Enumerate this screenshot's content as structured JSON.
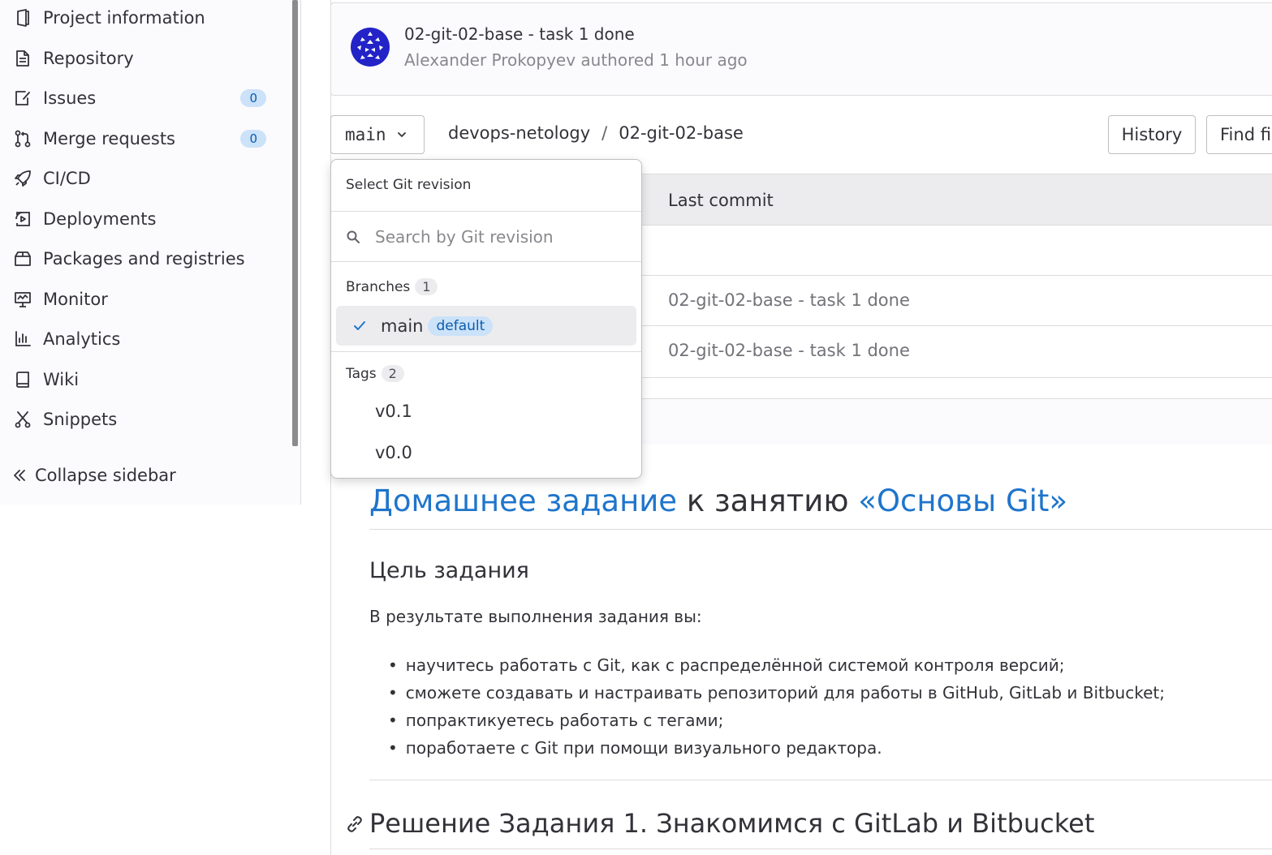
{
  "sidebar": {
    "items": [
      {
        "label": "Project information",
        "icon": "project-icon"
      },
      {
        "label": "Repository",
        "icon": "document-icon"
      },
      {
        "label": "Issues",
        "icon": "issues-icon",
        "badge": "0"
      },
      {
        "label": "Merge requests",
        "icon": "merge-request-icon",
        "badge": "0"
      },
      {
        "label": "CI/CD",
        "icon": "rocket-icon"
      },
      {
        "label": "Deployments",
        "icon": "deployments-icon"
      },
      {
        "label": "Packages and registries",
        "icon": "package-icon"
      },
      {
        "label": "Monitor",
        "icon": "monitor-icon"
      },
      {
        "label": "Analytics",
        "icon": "chart-icon"
      },
      {
        "label": "Wiki",
        "icon": "book-icon"
      },
      {
        "label": "Snippets",
        "icon": "snippet-icon"
      }
    ],
    "collapse_label": "Collapse sidebar"
  },
  "commit": {
    "title": "02-git-02-base - task 1 done",
    "meta": "Alexander Prokopyev authored 1 hour ago"
  },
  "toolbar": {
    "branch": "main",
    "breadcrumb": [
      "devops-netology",
      "/",
      "02-git-02-base"
    ],
    "history_label": "History",
    "find_label": "Find fil"
  },
  "table": {
    "header_last_commit": "Last commit",
    "rows": [
      {
        "message": "02-git-02-base - task 1 done"
      },
      {
        "message": "02-git-02-base - task 1 done"
      }
    ]
  },
  "dropdown": {
    "header": "Select Git revision",
    "search_placeholder": "Search by Git revision",
    "branches_label": "Branches",
    "branches_count": "1",
    "selected_branch": "main",
    "default_badge": "default",
    "tags_label": "Tags",
    "tags_count": "2",
    "tags": [
      "v0.1",
      "v0.0"
    ]
  },
  "readme": {
    "title_link1": "Домашнее задание",
    "title_plain": " к занятию ",
    "title_link2": "«Основы Git»",
    "h2": "Цель задания",
    "intro": "В результате выполнения задания вы:",
    "bullets": [
      "научитесь работать с Git, как с распределённой системой контроля версий;",
      "сможете создавать и настраивать репозиторий для работы в GitHub, GitLab и Bitbucket;",
      "попрактикуетесь работать с тегами;",
      "поработаете с Git при помощи визуального редактора."
    ],
    "h2b": "Решение Задания 1. Знакомимся с GitLab и Bitbucket"
  },
  "colors": {
    "link": "#1f75cb",
    "badge_bg": "#cbe2f9",
    "badge_text": "#0b5cad",
    "avatar": "#2323c8"
  }
}
